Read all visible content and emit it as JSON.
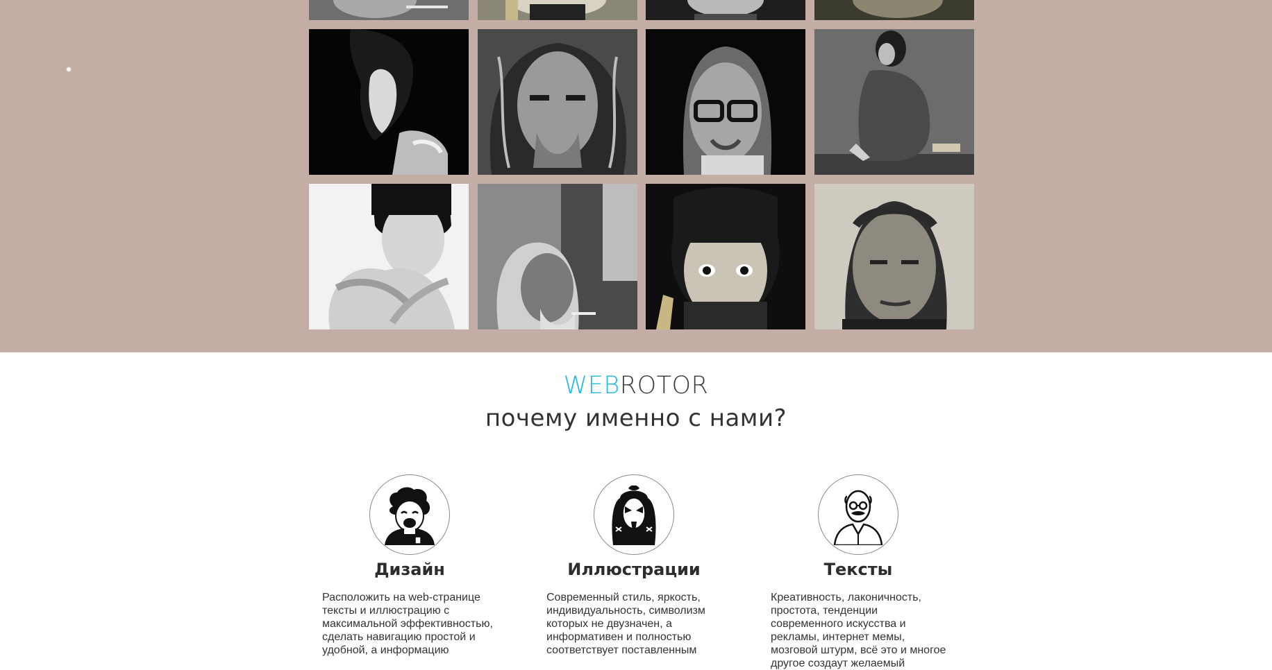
{
  "gallery": {
    "photos": [
      {
        "row": "top",
        "alt": "portrait-1"
      },
      {
        "row": "top",
        "alt": "portrait-2"
      },
      {
        "row": "top",
        "alt": "portrait-3"
      },
      {
        "row": "top",
        "alt": "portrait-4"
      },
      {
        "row": 1,
        "alt": "woman-profile"
      },
      {
        "row": 1,
        "alt": "curly-haired-man"
      },
      {
        "row": 1,
        "alt": "man-with-glasses"
      },
      {
        "row": 1,
        "alt": "sitting-woman"
      },
      {
        "row": 2,
        "alt": "woman-crossed-arms"
      },
      {
        "row": 2,
        "alt": "old-man-smoking"
      },
      {
        "row": 2,
        "alt": "girl-bangs"
      },
      {
        "row": 2,
        "alt": "weathered-man"
      }
    ]
  },
  "heading": {
    "brand_accent": "WEB",
    "brand_rest": "ROTOR",
    "tagline": "почему именно с нами?"
  },
  "features": [
    {
      "icon": "laughing-man-icon",
      "title": "Дизайн",
      "text": "Расположить на web-странице тексты и иллюстрацию с максимальной эффективностью, сделать навигацию простой и удобной, а информацию"
    },
    {
      "icon": "kiss-rocker-icon",
      "title": "Иллюстрации",
      "text": "Современный стиль, яркость, индивидуальность, символизм которых не двузначен, а информативен и полностью соответствует поставленным"
    },
    {
      "icon": "bald-glasses-man-icon",
      "title": "Тексты",
      "text": "Креативность, лаконичность, простота, тенденции современного искусства и рекламы, интернет мемы, мозговой штурм, всё это и многое другое создаут желаемый"
    }
  ],
  "colors": {
    "band": "#c4ada5",
    "accent": "#1fb8e0",
    "text": "#333333"
  }
}
